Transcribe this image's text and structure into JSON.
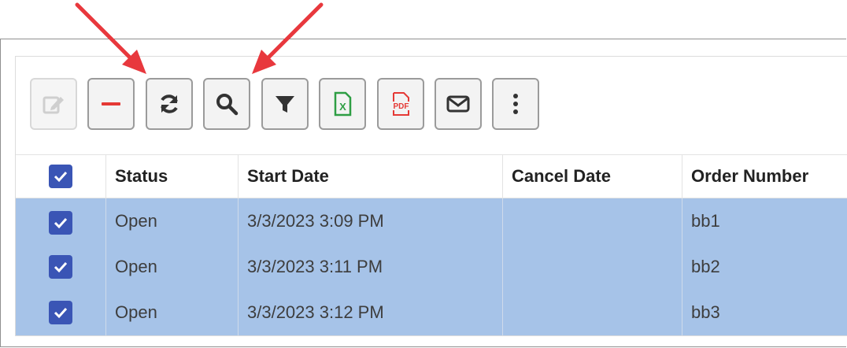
{
  "toolbar": {
    "buttons": [
      {
        "name": "edit-button",
        "icon": "edit-icon",
        "enabled": false
      },
      {
        "name": "delete-button",
        "icon": "minus-icon",
        "enabled": true
      },
      {
        "name": "refresh-button",
        "icon": "refresh-icon",
        "enabled": true
      },
      {
        "name": "search-button",
        "icon": "search-icon",
        "enabled": true
      },
      {
        "name": "filter-button",
        "icon": "filter-icon",
        "enabled": true
      },
      {
        "name": "export-excel-button",
        "icon": "excel-icon",
        "enabled": true
      },
      {
        "name": "export-pdf-button",
        "icon": "pdf-icon",
        "enabled": true
      },
      {
        "name": "email-button",
        "icon": "envelope-icon",
        "enabled": true
      },
      {
        "name": "more-button",
        "icon": "more-vertical-icon",
        "enabled": true
      }
    ],
    "pdf_label": "PDF",
    "excel_label": "X"
  },
  "grid": {
    "columns": [
      "Status",
      "Start Date",
      "Cancel Date",
      "Order Number"
    ],
    "select_all_checked": true,
    "rows": [
      {
        "checked": true,
        "status": "Open",
        "start_date": "3/3/2023 3:09 PM",
        "cancel_date": "",
        "order_number": "bb1"
      },
      {
        "checked": true,
        "status": "Open",
        "start_date": "3/3/2023 3:11 PM",
        "cancel_date": "",
        "order_number": "bb2"
      },
      {
        "checked": true,
        "status": "Open",
        "start_date": "3/3/2023 3:12 PM",
        "cancel_date": "",
        "order_number": "bb3"
      }
    ]
  },
  "colors": {
    "selected_row": "#a6c3e8",
    "checkbox": "#3a55b5",
    "arrow": "#e8383d",
    "delete_icon": "#e53935",
    "excel_icon": "#2e9e44",
    "pdf_icon": "#e53935"
  },
  "annotations": [
    {
      "name": "annotation-arrow-refresh",
      "points_to": "refresh-button"
    },
    {
      "name": "annotation-arrow-search",
      "points_to": "search-button"
    }
  ]
}
